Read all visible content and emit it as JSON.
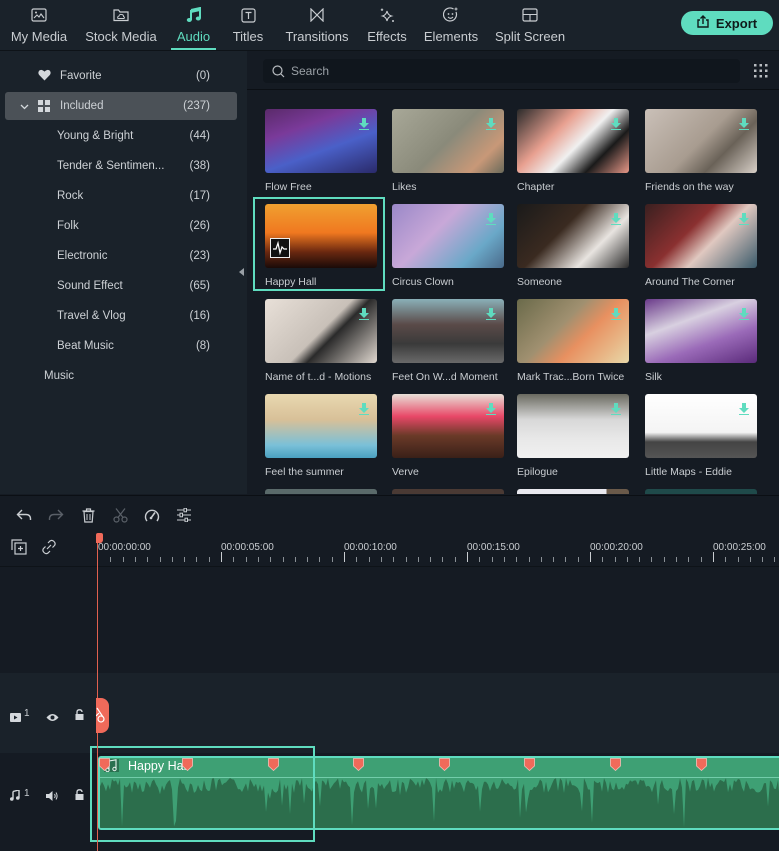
{
  "nav": {
    "tabs": [
      {
        "label": "My Media",
        "icon": "image-icon"
      },
      {
        "label": "Stock Media",
        "icon": "cloud-folder-icon"
      },
      {
        "label": "Audio",
        "icon": "music-note-icon",
        "active": true
      },
      {
        "label": "Titles",
        "icon": "text-t-icon"
      },
      {
        "label": "Transitions",
        "icon": "bowtie-icon"
      },
      {
        "label": "Effects",
        "icon": "sparkle-icon"
      },
      {
        "label": "Elements",
        "icon": "smiley-icon"
      },
      {
        "label": "Split Screen",
        "icon": "split-screen-icon"
      }
    ],
    "export_label": "Export",
    "accent": "#5fdcbf"
  },
  "sidebar": {
    "favorite": {
      "label": "Favorite",
      "count": "(0)"
    },
    "included": {
      "label": "Included",
      "count": "(237)"
    },
    "categories": [
      {
        "label": "Young & Bright",
        "count": "(44)"
      },
      {
        "label": "Tender & Sentimen...",
        "count": "(38)"
      },
      {
        "label": "Rock",
        "count": "(17)"
      },
      {
        "label": "Folk",
        "count": "(26)"
      },
      {
        "label": "Electronic",
        "count": "(23)"
      },
      {
        "label": "Sound Effect",
        "count": "(65)"
      },
      {
        "label": "Travel & Vlog",
        "count": "(16)"
      },
      {
        "label": "Beat Music",
        "count": "(8)"
      }
    ],
    "music": {
      "label": "Music"
    }
  },
  "library": {
    "search_placeholder": "Search",
    "items": [
      {
        "title": "Flow Free"
      },
      {
        "title": "Likes"
      },
      {
        "title": "Chapter"
      },
      {
        "title": "Friends on the way"
      },
      {
        "title": "Happy Hall",
        "selected": true
      },
      {
        "title": "Circus Clown"
      },
      {
        "title": "Someone"
      },
      {
        "title": "Around The Corner"
      },
      {
        "title": "Name of t...d - Motions"
      },
      {
        "title": "Feet On W...d Moment"
      },
      {
        "title": "Mark Trac...Born Twice"
      },
      {
        "title": "Silk"
      },
      {
        "title": "Feel the summer"
      },
      {
        "title": "Verve"
      },
      {
        "title": "Epilogue"
      },
      {
        "title": "Little Maps - Eddie"
      }
    ]
  },
  "timeline": {
    "toolbar": [
      "undo-icon",
      "redo-icon",
      "delete-icon",
      "cut-icon",
      "speed-icon",
      "adjust-icon"
    ],
    "timecodes": [
      "00:00:00:00",
      "00:00:05:00",
      "00:00:10:00",
      "00:00:15:00",
      "00:00:20:00",
      "00:00:25:00"
    ],
    "video_track": {
      "number": "1"
    },
    "audio_track": {
      "number": "1"
    },
    "audio_clip": {
      "title": "Happy Hall"
    },
    "playhead_color": "#f06a5a"
  }
}
